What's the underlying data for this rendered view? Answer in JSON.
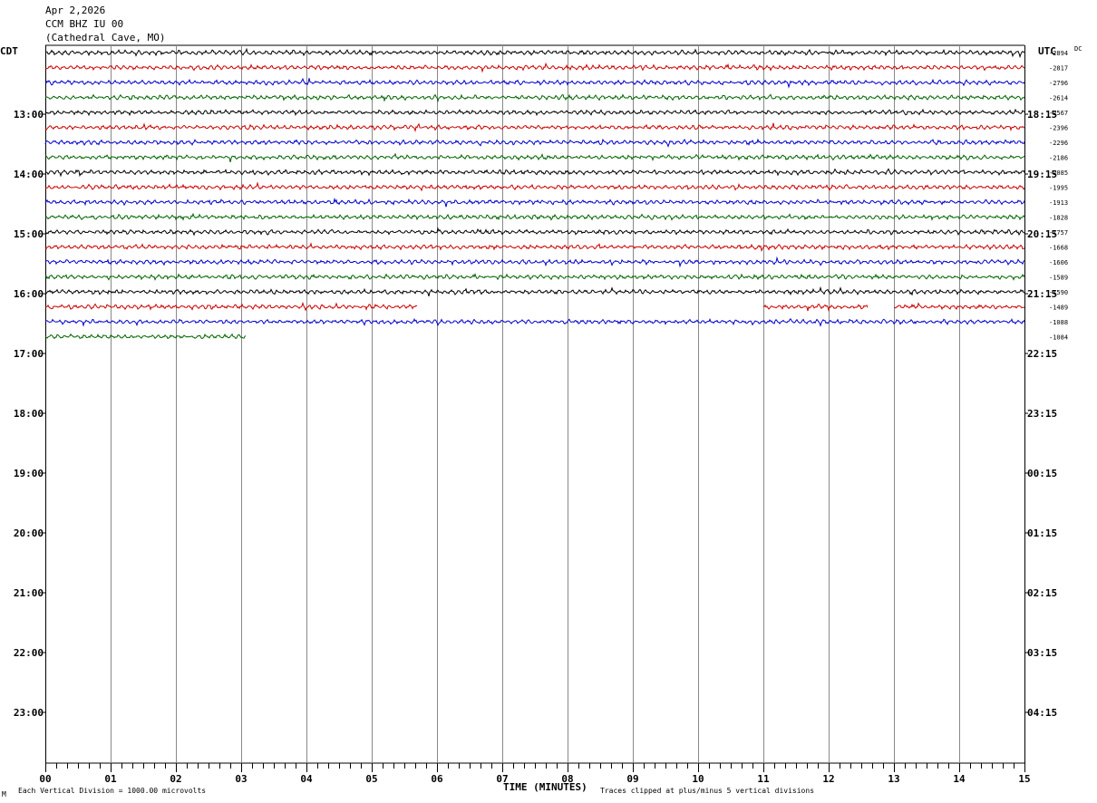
{
  "header": {
    "date": "Apr 2,2026",
    "station": "CCM BHZ IU 00",
    "location": "(Cathedral Cave, MO)"
  },
  "left_axis_title": "CDT",
  "right_axis_title": "UTC",
  "dc_label": "DC",
  "footer": {
    "scale_note": "Each Vertical Division = 1000.00 microvolts",
    "clip_note": "Traces clipped at plus/minus 5 vertical divisions",
    "corner_mark": "M"
  },
  "chart_data": {
    "type": "line",
    "xlabel": "TIME (MINUTES)",
    "xlim": [
      0,
      15
    ],
    "x_ticks": [
      "00",
      "01",
      "02",
      "03",
      "04",
      "05",
      "06",
      "07",
      "08",
      "09",
      "10",
      "11",
      "12",
      "13",
      "14",
      "15"
    ],
    "left_time_labels": [
      "13:00",
      "14:00",
      "15:00",
      "16:00",
      "17:00",
      "18:00",
      "19:00",
      "20:00",
      "21:00",
      "22:00",
      "23:00"
    ],
    "right_time_labels": [
      "18:15",
      "19:15",
      "20:15",
      "21:15",
      "22:15",
      "23:15",
      "00:15",
      "01:15",
      "02:15",
      "03:15",
      "04:15"
    ],
    "trace_colors": [
      "#000000",
      "#cc0000",
      "#0000cc",
      "#006400"
    ],
    "rows": [
      {
        "offset": "-2894",
        "segments": [
          [
            0,
            15
          ]
        ]
      },
      {
        "offset": "-2817",
        "segments": [
          [
            0,
            15
          ]
        ]
      },
      {
        "offset": "-2796",
        "segments": [
          [
            0,
            15
          ]
        ]
      },
      {
        "offset": "-2614",
        "segments": [
          [
            0,
            15
          ]
        ]
      },
      {
        "offset": "-2567",
        "segments": [
          [
            0,
            15
          ]
        ]
      },
      {
        "offset": "-2396",
        "segments": [
          [
            0,
            15
          ]
        ]
      },
      {
        "offset": "-2296",
        "segments": [
          [
            0,
            15
          ]
        ]
      },
      {
        "offset": "-2186",
        "segments": [
          [
            0,
            15
          ]
        ]
      },
      {
        "offset": "-2085",
        "segments": [
          [
            0,
            15
          ]
        ]
      },
      {
        "offset": "-1995",
        "segments": [
          [
            0,
            15
          ]
        ]
      },
      {
        "offset": "-1913",
        "segments": [
          [
            0,
            15
          ]
        ]
      },
      {
        "offset": "-1828",
        "segments": [
          [
            0,
            15
          ]
        ]
      },
      {
        "offset": "-1757",
        "segments": [
          [
            0,
            15
          ]
        ]
      },
      {
        "offset": "-1668",
        "segments": [
          [
            0,
            15
          ]
        ]
      },
      {
        "offset": "-1606",
        "segments": [
          [
            0,
            15
          ]
        ]
      },
      {
        "offset": "-1589",
        "segments": [
          [
            0,
            15
          ]
        ]
      },
      {
        "offset": "-1590",
        "segments": [
          [
            0,
            15
          ]
        ]
      },
      {
        "offset": "-1489",
        "segments": [
          [
            0,
            5.7
          ],
          [
            11,
            12.6
          ],
          [
            13,
            15
          ]
        ]
      },
      {
        "offset": "-1088",
        "segments": [
          [
            0,
            15
          ]
        ]
      },
      {
        "offset": "-1084",
        "segments": [
          [
            0,
            3.07
          ]
        ]
      }
    ]
  }
}
